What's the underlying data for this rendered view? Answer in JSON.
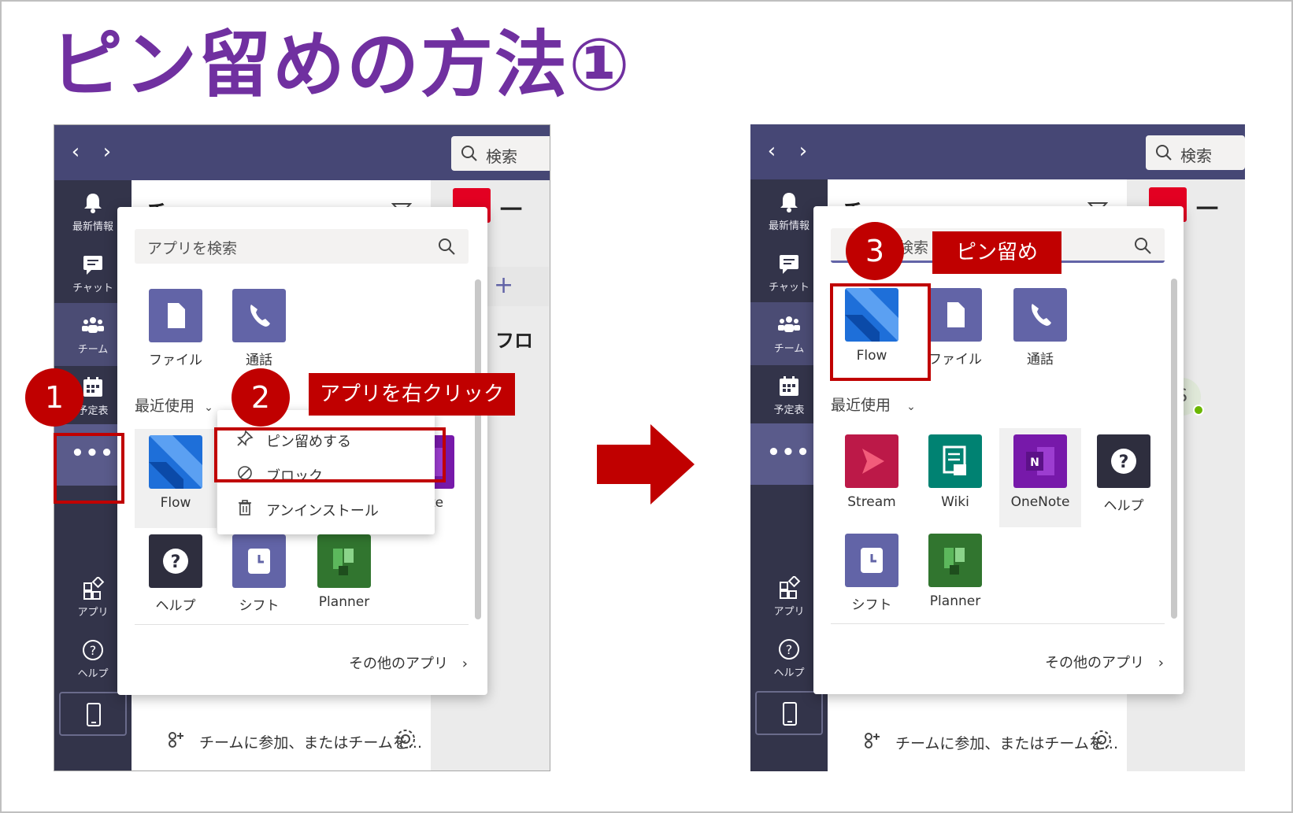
{
  "slide_title": "ピン留めの方法①",
  "search_label": "検索",
  "rail": {
    "activity": "最新情報",
    "chat": "チャット",
    "teams": "チーム",
    "calendar": "予定表",
    "more": "•••",
    "apps": "アプリ",
    "help": "ヘルプ"
  },
  "background": {
    "header_fragment": "チー",
    "right_fragment": "一",
    "side_fragment": "フロ",
    "avatar_initial": "S"
  },
  "flyout": {
    "search_placeholder": "アプリを検索",
    "recent_label": "最近使用",
    "more_apps": "その他のアプリ",
    "partial_search": "検索"
  },
  "bottom_bar": {
    "join_text": "チームに参加、またはチームを..."
  },
  "left_pinned_apps": [
    {
      "label": "ファイル"
    },
    {
      "label": "通話"
    }
  ],
  "left_recent_apps": [
    {
      "label": "Flow"
    },
    {
      "label": "OneNote",
      "visible_fragment": "Note"
    },
    {
      "label": "ヘルプ"
    },
    {
      "label": "シフト"
    },
    {
      "label": "Planner"
    }
  ],
  "context_menu": [
    {
      "label": "ピン留めする",
      "icon": "pin-icon"
    },
    {
      "label": "ブロック",
      "icon": "block-icon"
    },
    {
      "label": "アンインストール",
      "icon": "trash-icon"
    }
  ],
  "right_pinned_apps": [
    {
      "label": "Flow"
    },
    {
      "label": "ファイル"
    },
    {
      "label": "通話"
    }
  ],
  "right_recent_apps": [
    {
      "label": "Stream"
    },
    {
      "label": "Wiki"
    },
    {
      "label": "OneNote"
    },
    {
      "label": "ヘルプ"
    },
    {
      "label": "シフト"
    },
    {
      "label": "Planner"
    }
  ],
  "annotations": {
    "step1": "1",
    "step2": "2",
    "step3": "3",
    "callout_right_click": "アプリを右クリック",
    "callout_pin": "ピン留め"
  },
  "colors": {
    "title_purple": "#7030a0",
    "annotation_red": "#c00000",
    "teams_topbar": "#464775",
    "teams_rail": "#33344a",
    "app_purple": "#6264a7",
    "flow_blue": "#0f6cbd",
    "stream_red": "#bc1948",
    "wiki_green": "#008272",
    "onenote_purple": "#7719aa",
    "planner_green": "#31752f",
    "help_dark": "#2e2e3e"
  }
}
